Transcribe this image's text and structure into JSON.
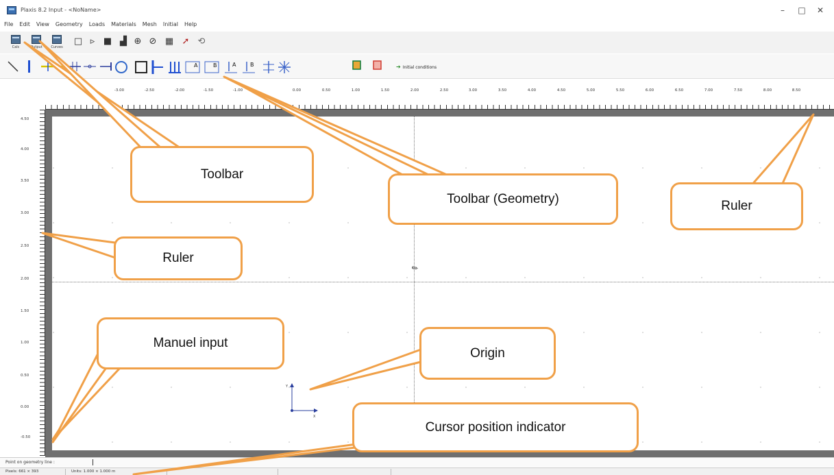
{
  "window": {
    "title": "Plaxis 8.2 Input - <NoName>",
    "minimize_glyph": "–",
    "maximize_glyph": "□",
    "close_glyph": "✕"
  },
  "menu": [
    "File",
    "Edit",
    "View",
    "Geometry",
    "Loads",
    "Materials",
    "Mesh",
    "Initial",
    "Help"
  ],
  "main_toolbar": {
    "program_buttons": [
      "Calc",
      "Output",
      "Curves"
    ],
    "tool_icons": [
      "new-file-icon",
      "open-folder-icon",
      "save-icon",
      "print-icon",
      "zoom-in-icon",
      "zoom-out-icon",
      "table-icon",
      "selection-arrow-icon",
      "undo-icon"
    ]
  },
  "geometry_toolbar": {
    "tool_icons": [
      "geometry-line-icon",
      "plate-icon",
      "geogrid-icon",
      "node-to-node-anchor-icon",
      "fixed-end-anchor-icon",
      "tunnel-icon",
      "interface-icon",
      "standard-fixities-icon",
      "horizontal-fixity-icon",
      "vertical-fixity-icon",
      "distributed-load-a-icon",
      "distributed-load-b-icon",
      "point-load-a-icon",
      "point-load-b-icon",
      "prescribed-displacement-icon",
      "rotation-fixity-icon",
      "drain-icon",
      "well-icon"
    ],
    "initial_conditions_label": "Initial conditions",
    "colors": {
      "line": "#333333",
      "plate": "#1f4fd1",
      "geogrid": "#d8c400",
      "anchor": "#2e3f9e",
      "tunnel": "#2f66c9",
      "load": "#3a62c8",
      "initial": "#2a8a2a"
    }
  },
  "ruler_top": {
    "labels": [
      "-3.50",
      "-3.00",
      "-2.50",
      "-2.00",
      "-1.50",
      "-1.00",
      "0.00",
      "0.50",
      "1.00",
      "1.50",
      "2.00",
      "2.50",
      "3.00",
      "3.50",
      "4.00",
      "4.50",
      "5.00",
      "5.50",
      "6.00",
      "6.50",
      "7.00",
      "7.50",
      "8.00",
      "8.50"
    ]
  },
  "ruler_left": {
    "labels": [
      "4.50",
      "4.00",
      "3.50",
      "3.00",
      "2.50",
      "2.00",
      "1.50",
      "1.00",
      "0.50",
      "0.00",
      "-0.50"
    ]
  },
  "status": {
    "message": "Point on geometry line :",
    "pixels": "Pixels: 661 × 393",
    "units": "Units: 1.000 × 1.000 m"
  },
  "callouts": {
    "toolbar": "Toolbar",
    "toolbar_geometry": "Toolbar (Geometry)",
    "ruler_right": "Ruler",
    "ruler_left": "Ruler",
    "manual_input": "Manuel input",
    "origin": "Origin",
    "cursor_position": "Cursor position indicator",
    "border_color": "#f0a048"
  },
  "axes": {
    "y_label": "Y",
    "x_label": "X"
  }
}
